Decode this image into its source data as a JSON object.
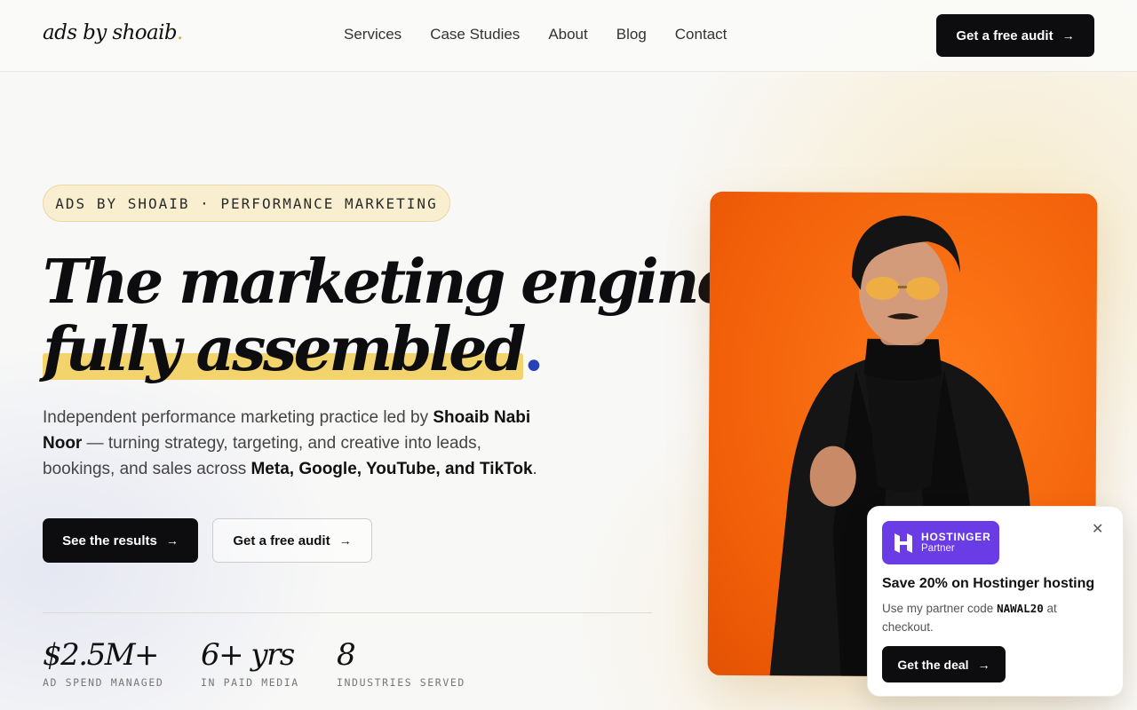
{
  "header": {
    "logo_text": "ads by shoaib",
    "logo_dot": ".",
    "nav": [
      "Services",
      "Case Studies",
      "About",
      "Blog",
      "Contact"
    ],
    "cta_label": "Get a free audit"
  },
  "hero": {
    "eyebrow": "ADS BY SHOAIB · PERFORMANCE MARKETING",
    "headline_line1": "The marketing engine,",
    "headline_line2": "fully assembled",
    "headline_dot": ".",
    "lede": {
      "part1": "Independent performance marketing practice led by ",
      "name": "Shoaib Nabi Noor",
      "part2": " — turning strategy, targeting, and creative into leads, bookings, and sales across ",
      "platforms": "Meta, Google, YouTube, and TikTok",
      "part3": "."
    },
    "primary_button": "See the results",
    "secondary_button": "Get a free audit",
    "stats": [
      {
        "value": "$2.5M+",
        "label": "AD SPEND MANAGED"
      },
      {
        "value": "6+ yrs",
        "label": "IN PAID MEDIA"
      },
      {
        "value": "8",
        "label": "INDUSTRIES SERVED"
      }
    ]
  },
  "promo": {
    "badge_brand": "HOSTINGER",
    "badge_sub": "Partner",
    "title": "Save 20% on Hostinger hosting",
    "text_before": "Use my partner code ",
    "code": "NAWAL20",
    "text_after": " at checkout.",
    "button": "Get the deal",
    "close_glyph": "✕"
  },
  "icons": {
    "arrow": "arrow-right-icon"
  },
  "colors": {
    "accent_yellow": "#f3d36c",
    "dark": "#0d0d10",
    "portrait_orange": "#f15f08",
    "promo_purple": "#6a3ce6",
    "dot_blue": "#2742b8"
  }
}
